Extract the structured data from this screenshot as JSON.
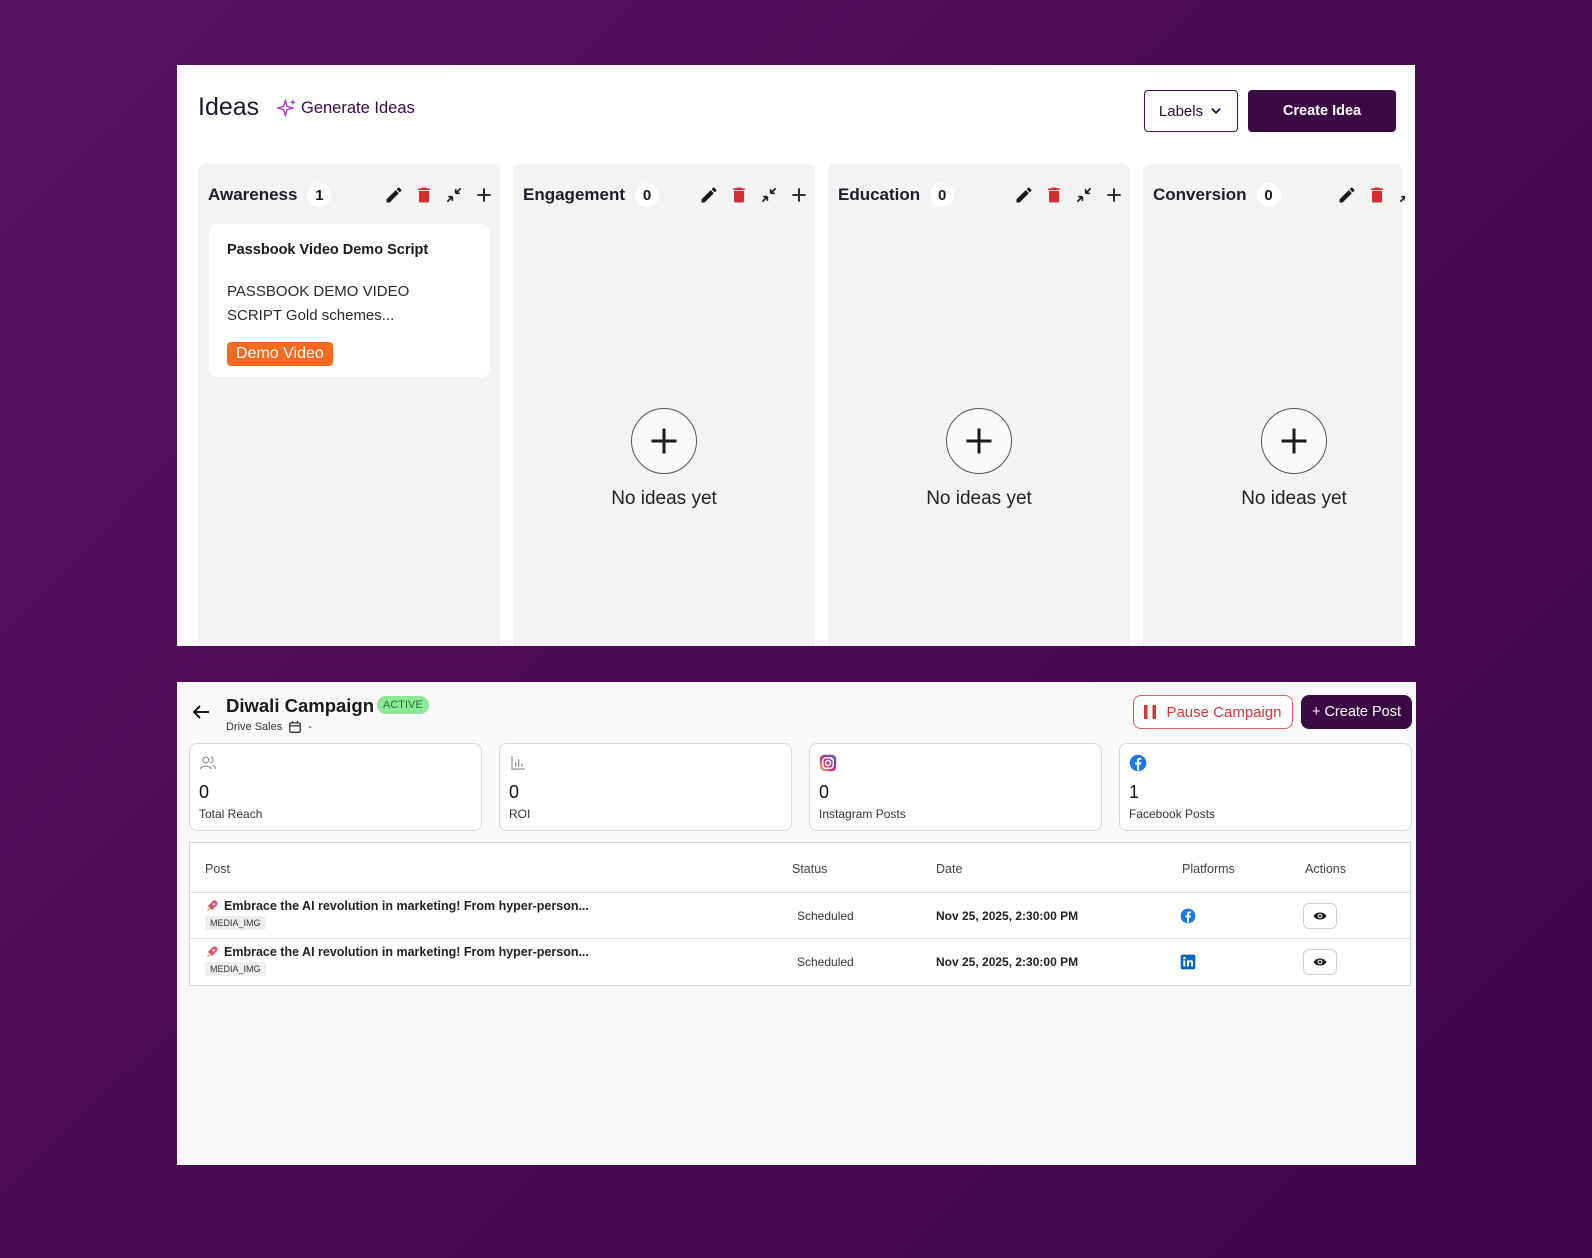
{
  "ideas": {
    "title": "Ideas",
    "generate_label": "Generate Ideas",
    "labels_button": "Labels",
    "create_button": "Create Idea",
    "columns": [
      {
        "name": "Awareness",
        "count": "1",
        "cards": [
          {
            "title": "Passbook Video Demo Script",
            "body": "PASSBOOK DEMO VIDEO SCRIPT Gold schemes...",
            "tag": "Demo Video"
          }
        ]
      },
      {
        "name": "Engagement",
        "count": "0",
        "empty_text": "No ideas yet"
      },
      {
        "name": "Education",
        "count": "0",
        "empty_text": "No ideas yet"
      },
      {
        "name": "Conversion",
        "count": "0",
        "empty_text": "No ideas yet"
      }
    ],
    "colors": {
      "tag_bg": "#f76b20",
      "primary": "#3b0a45",
      "delete_icon": "#d32f2f"
    }
  },
  "campaign": {
    "title": "Diwali Campaign",
    "badge": "ACTIVE",
    "goal": "Drive Sales",
    "date": "-",
    "pause_button": "Pause Campaign",
    "create_post_button": "+ Create Post",
    "stats": [
      {
        "icon": "users-icon",
        "value": "0",
        "label": "Total Reach"
      },
      {
        "icon": "bar-chart-icon",
        "value": "0",
        "label": "ROI"
      },
      {
        "icon": "instagram-icon",
        "value": "0",
        "label": "Instagram Posts"
      },
      {
        "icon": "facebook-icon",
        "value": "1",
        "label": "Facebook Posts"
      }
    ],
    "table": {
      "headers": {
        "post": "Post",
        "status": "Status",
        "date": "Date",
        "platforms": "Platforms",
        "actions": "Actions"
      },
      "rows": [
        {
          "post": "Embrace the AI revolution in marketing! From hyper-person...",
          "media": "MEDIA_IMG",
          "status": "Scheduled",
          "date": "Nov 25, 2025, 2:30:00 PM",
          "platform": "facebook-icon"
        },
        {
          "post": "Embrace the AI revolution in marketing! From hyper-person...",
          "media": "MEDIA_IMG",
          "status": "Scheduled",
          "date": "Nov 25, 2025, 2:30:00 PM",
          "platform": "linkedin-icon"
        }
      ]
    },
    "colors": {
      "active_badge_bg": "#8ee89a",
      "pause_red": "#d4363c",
      "facebook_blue": "#1877f2",
      "linkedin_blue": "#0a66c2"
    }
  }
}
